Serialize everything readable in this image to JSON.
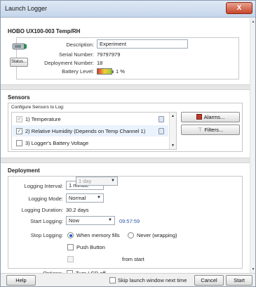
{
  "window": {
    "title": "Launch Logger",
    "close_label": "X"
  },
  "device": {
    "header": "HOBO UX100-003 Temp/RH",
    "description_label": "Description:",
    "description_value": "Experiment",
    "serial_label": "Serial Number:",
    "serial_value": "79797979",
    "deployment_label": "Deployment Number:",
    "deployment_value": "18",
    "battery_label": "Battery Level:",
    "battery_value": "1 %",
    "status_button": "Status..."
  },
  "sensors": {
    "section_title": "Sensors",
    "configure_label": "Configure Sensors to Log:",
    "items": [
      {
        "label": "1) Temperature",
        "checked": true,
        "disabled": true,
        "selected": false
      },
      {
        "label": "2) Relative Humidity (Depends on Temp Channel 1)",
        "checked": true,
        "disabled": false,
        "selected": true
      },
      {
        "label": "3) Logger's Battery Voltage",
        "checked": false,
        "disabled": false,
        "selected": false
      }
    ],
    "alarms_button": "Alarms...",
    "filters_button": "Filters..."
  },
  "deployment": {
    "section_title": "Deployment",
    "interval_label": "Logging Interval:",
    "interval_value": "1 minute",
    "mode_label": "Logging Mode:",
    "mode_value": "Normal",
    "duration_label": "Logging Duration:",
    "duration_value": "30.2 days",
    "start_label": "Start Logging:",
    "start_value": "Now",
    "start_time": "09:57:59",
    "stop_label": "Stop Logging:",
    "stop_option_memory": "When memory fills",
    "stop_option_never": "Never (wrapping)",
    "push_button_label": "Push Button",
    "duration_combo_value": "1 day",
    "from_start_label": "from start",
    "options_label": "Options:",
    "lcd_label": "Turn LCD off"
  },
  "footer": {
    "help": "Help",
    "skip_label": "Skip launch window next time",
    "cancel": "Cancel",
    "start": "Start"
  },
  "colors": {
    "accent": "#1f5fc5",
    "time_text": "#2b57a8",
    "alarm_icon": "#c0392b"
  }
}
